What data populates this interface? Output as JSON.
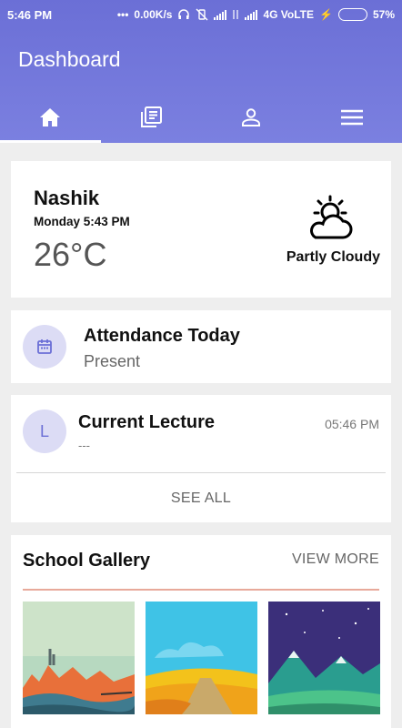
{
  "status_bar": {
    "time": "5:46 PM",
    "speed": "0.00K/s",
    "network": "4G VoLTE",
    "battery": "57%",
    "battery_level": 0.57
  },
  "app": {
    "title": "Dashboard"
  },
  "tabs": [
    {
      "icon": "home-icon"
    },
    {
      "icon": "library-books-icon"
    },
    {
      "icon": "person-icon"
    },
    {
      "icon": "menu-icon"
    }
  ],
  "weather": {
    "city": "Nashik",
    "datetime": "Monday  5:43 PM",
    "temperature": "26°C",
    "condition": "Partly Cloudy",
    "icon": "partly-cloudy-icon"
  },
  "attendance": {
    "title": "Attendance Today",
    "status": "Present",
    "icon": "calendar-icon"
  },
  "lecture": {
    "avatar_letter": "L",
    "title": "Current Lecture",
    "subtitle": "---",
    "time": "05:46 PM",
    "see_all": "SEE ALL"
  },
  "gallery": {
    "title": "School Gallery",
    "view_more": "VIEW MORE"
  },
  "colors": {
    "primary": "#6b6fd6",
    "avatar_bg": "#dcdcf5",
    "divider_accent": "#e8a99a"
  }
}
